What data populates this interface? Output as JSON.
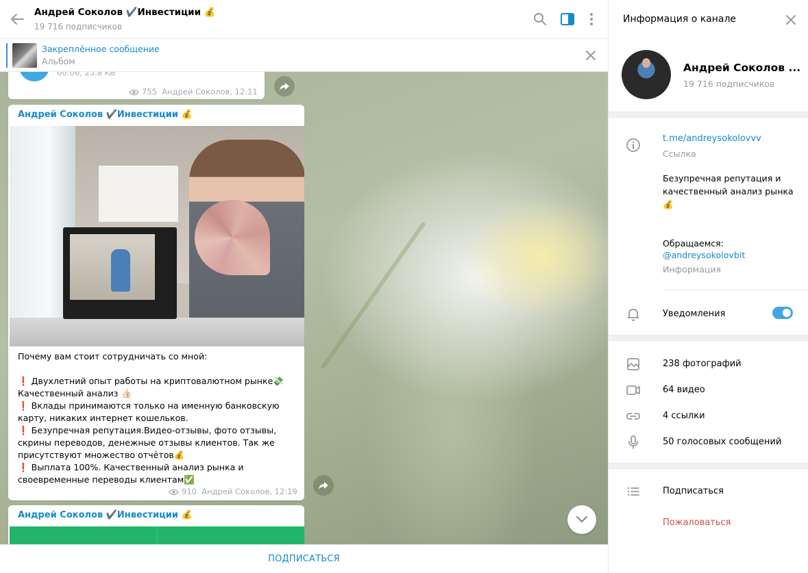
{
  "chat": {
    "title": "Андрей Соколов ✔️Инвестиции 💰",
    "subscribers": "19 716 подписчиков",
    "pinned": {
      "title": "Закреплённое сообщение",
      "subtitle": "Альбом"
    },
    "messages": [
      {
        "type": "audio",
        "duration_size": "00:06, 25.8 KB",
        "views": "755",
        "author_time": "Андрей Соколов, 12:11"
      },
      {
        "type": "photo",
        "author": "Андрей Соколов ✔️Инвестиции 💰",
        "text": "Почему вам стоит сотрудничать со мной:\n\n❗ Двухлетний опыт работы на криптовалютном рынке💸\nКачественный анализ 👍🏻\n❗ Вклады принимаются только на именную банковскую карту, никаких интернет кошельков.\n❗ Безупречная репутация.Видео-отзывы, фото отзывы, скрины переводов, денежные отзывы клиентов. Так же присутствуют множество отчётов💰\n❗ Выплата 100%. Качественный анализ рынка и своевременные переводы клиентам✅",
        "views": "910",
        "author_time": "Андрей Соколов, 12:19"
      },
      {
        "type": "photo",
        "author": "Андрей Соколов ✔️Инвестиции 💰"
      }
    ],
    "subscribe_button": "ПОДПИСАТЬСЯ"
  },
  "info": {
    "title": "Информация о канале",
    "name": "Андрей Соколов ...",
    "subscribers": "19 716 подписчиков",
    "link": "t.me/andreysokolovvv",
    "link_label": "Ссылка",
    "description": "Безупречная репутация и качественный анализ рынка 💰",
    "contact_line": "Обращаемся:",
    "contact_handle": "@andreysokolovbit",
    "description_label": "Информация",
    "notifications_label": "Уведомления",
    "notifications_on": true,
    "media": {
      "photos": "238 фотографий",
      "videos": "64 видео",
      "links": "4 ссылки",
      "voice": "50 голосовых сообщений"
    },
    "actions": {
      "subscribe": "Подписаться",
      "report": "Пожаловаться"
    }
  },
  "colors": {
    "accent": "#168acd",
    "toggle": "#40a7e3",
    "danger": "#d14e4e"
  }
}
